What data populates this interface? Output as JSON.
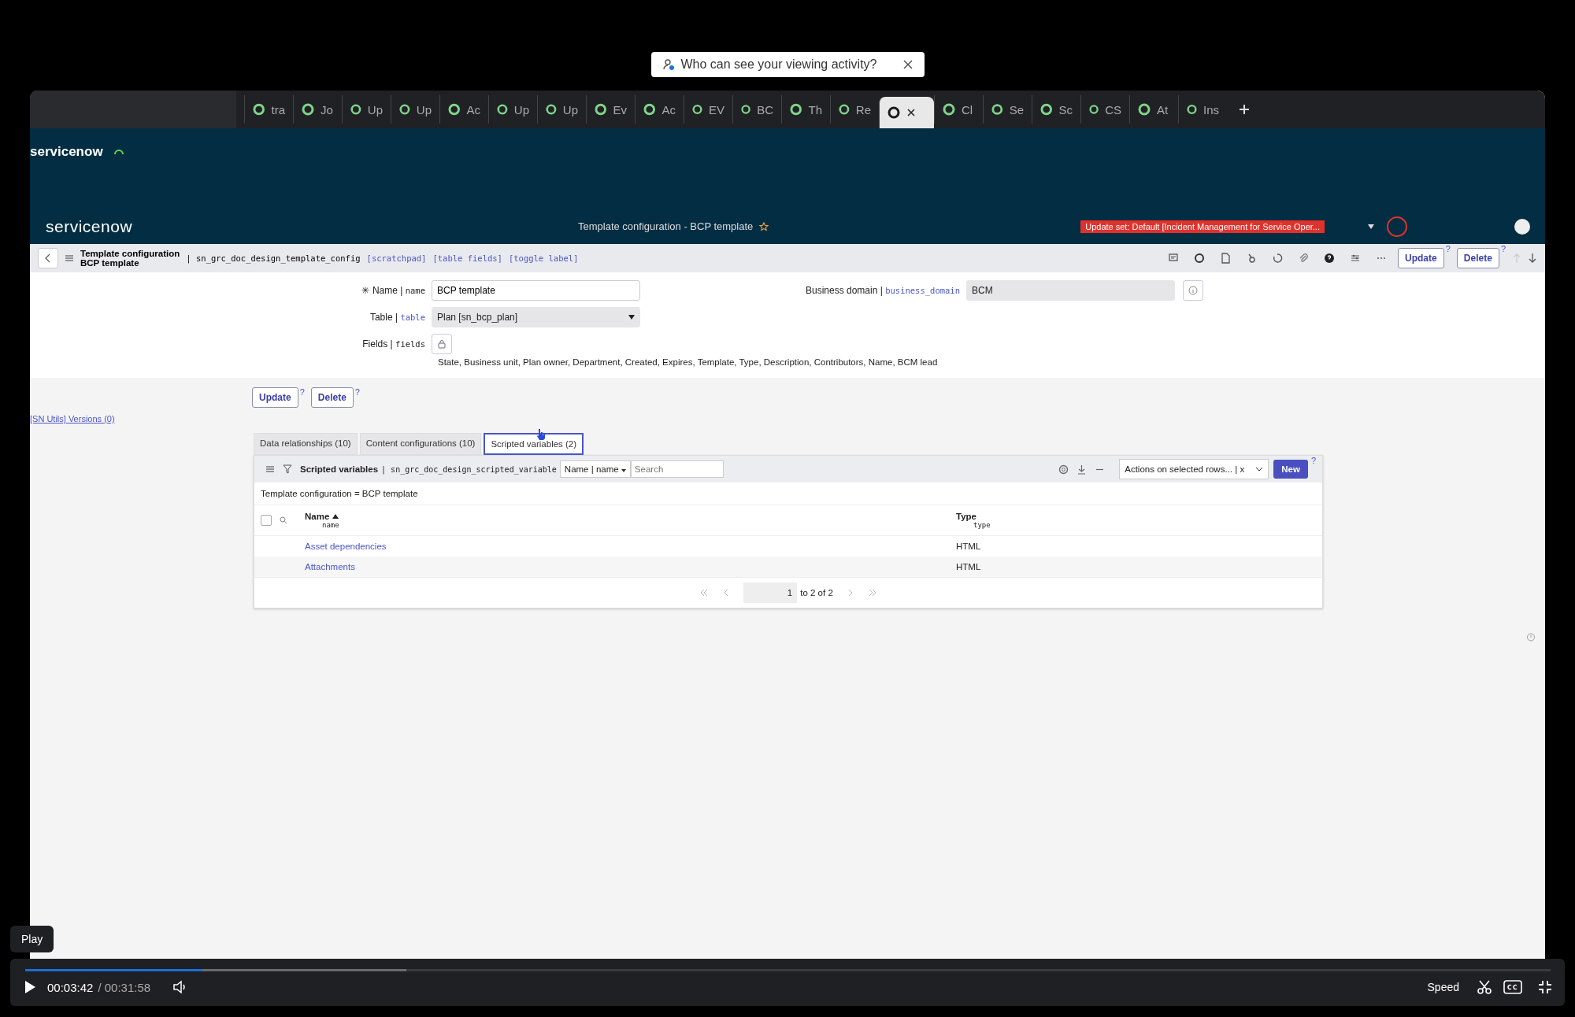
{
  "toast": {
    "text": "Who can see your viewing activity?"
  },
  "browser_tabs": [
    {
      "label": "tra",
      "selected": false
    },
    {
      "label": "Jo",
      "selected": false
    },
    {
      "label": "Up",
      "selected": false
    },
    {
      "label": "Up",
      "selected": false
    },
    {
      "label": "Ac",
      "selected": false
    },
    {
      "label": "Up",
      "selected": false
    },
    {
      "label": "Up",
      "selected": false
    },
    {
      "label": "Ev",
      "selected": false
    },
    {
      "label": "Ac",
      "selected": false
    },
    {
      "label": "EV",
      "selected": false
    },
    {
      "label": "BC",
      "selected": false
    },
    {
      "label": "Th",
      "selected": false
    },
    {
      "label": "Re",
      "selected": false
    },
    {
      "selected": true
    },
    {
      "label": "Cl",
      "selected": false
    },
    {
      "label": "Se",
      "selected": false
    },
    {
      "label": "Sc",
      "selected": false
    },
    {
      "label": "CS",
      "selected": false
    },
    {
      "label": "At",
      "selected": false
    },
    {
      "label": "Ins",
      "selected": false
    }
  ],
  "app_header": {
    "logo": "servicenow"
  },
  "nav": {
    "logo": "servicenow",
    "title": "Template configuration - BCP template",
    "update_set": "Update set: Default [Incident Management for Service Oper..."
  },
  "form_header": {
    "title": "Template configuration",
    "subtitle": "BCP template",
    "table": "| sn_grc_doc_design_template_config",
    "links": [
      "[scratchpad]",
      "[table fields]",
      "[toggle label]"
    ],
    "buttons": [
      {
        "label": "Update",
        "help": "?"
      },
      {
        "label": "Delete",
        "help": "?"
      }
    ]
  },
  "fields": {
    "name": {
      "label": "Name |",
      "field": "name",
      "value": "BCP template",
      "required_mark": "✳"
    },
    "table": {
      "label": "Table |",
      "field": "table",
      "value": "Plan [sn_bcp_plan]"
    },
    "fields": {
      "label": "Fields |",
      "field": "fields",
      "value": "State, Business unit, Plan owner, Department, Created, Expires, Template, Type, Description, Contributors, Name, BCM lead"
    },
    "business_domain": {
      "label": "Business domain |",
      "field": "business_domain",
      "value": "BCM"
    }
  },
  "form_buttons": [
    {
      "label": "Update",
      "help": "?"
    },
    {
      "label": "Delete",
      "help": "?"
    }
  ],
  "sn_utils_link": "[SN Utils] Versions (0)",
  "related_tabs": [
    {
      "label": "Data relationships (10)",
      "selected": false
    },
    {
      "label": "Content configurations (10)",
      "selected": false
    },
    {
      "label": "Scripted variables (2)",
      "selected": true
    }
  ],
  "list": {
    "title": "Scripted variables",
    "table": "| sn_grc_doc_design_scripted_variable",
    "search_field": "Name | name",
    "search_placeholder": "Search",
    "actions": "Actions on selected rows... | x",
    "new": "New",
    "help": "?",
    "filter": "Template configuration = BCP template",
    "select_all_checked": false,
    "columns": [
      {
        "label": "Name",
        "field": "name",
        "sorted": true
      },
      {
        "label": "Type",
        "field": "type",
        "sorted": false
      }
    ],
    "rows": [
      [
        "Asset dependencies",
        "HTML"
      ],
      [
        "Attachments",
        "HTML"
      ]
    ],
    "pagination": {
      "page": "1",
      "range": "to 2 of 2"
    }
  },
  "player": {
    "tooltip": "Play",
    "time": "00:03:42",
    "duration": "/ 00:31:58",
    "level": 0.116,
    "speed": "Speed"
  }
}
